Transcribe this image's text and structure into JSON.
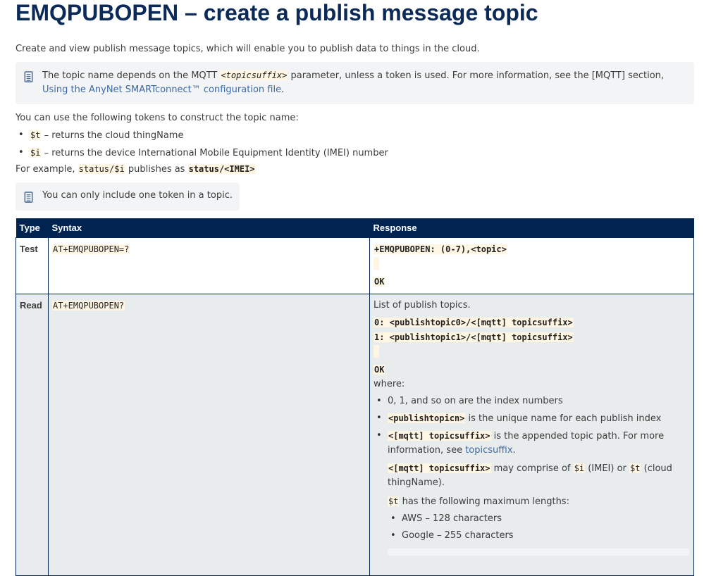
{
  "title": "EMQPUBOPEN – create a publish message topic",
  "intro": "Create and view publish message topics, which will enable you to publish data to things in the cloud.",
  "note1": {
    "pre": "The topic name depends on the MQTT ",
    "code": "<topicsuffix>",
    "post": " parameter, unless a token is used. For more information, see the [MQTT] section, ",
    "link": "Using the AnyNet SMARTconnect™ configuration file",
    "end": "."
  },
  "tokens_intro": "You can use the following tokens to construct the topic name:",
  "tokens": [
    {
      "code": "$t",
      "text": " – returns the cloud thingName"
    },
    {
      "code": "$i",
      "text": " – returns the device International Mobile Equipment Identity (IMEI) number"
    }
  ],
  "example": {
    "pre": "For example, ",
    "code1": "status/$i",
    "mid": " publishes as ",
    "code2": "status/<IMEI>"
  },
  "note2": "You can only include one token in a topic.",
  "table": {
    "headers": [
      "Type",
      "Syntax",
      "Response"
    ],
    "rows": [
      {
        "type": "Test",
        "syntax": "AT+EMQPUBOPEN=?",
        "resp1": "+EMQPUBOPEN: (0-7),<topic>",
        "ok": "OK"
      },
      {
        "type": "Read",
        "syntax": "AT+EMQPUBOPEN?",
        "list": "List of publish topics.",
        "line0": "0: <publishtopic0>/<[mqtt] topicsuffix>",
        "line1": "1: <publishtopic1>/<[mqtt] topicsuffix>",
        "ok": "OK",
        "where": "where:",
        "b1": "0, 1, and so on are the index numbers",
        "b2code": "<publishtopicn>",
        "b2": " is the unique name for each publish index",
        "b3code": "<[mqtt] topicsuffix>",
        "b3": " is the appended topic path. For more information, see ",
        "b3link": "topicsuffix",
        "b3end": ".",
        "p1code": "<[mqtt] topicsuffix>",
        "p1a": " may comprise of ",
        "p1c1": "$i",
        "p1b": " (IMEI) or ",
        "p1c2": "$t",
        "p1c": " (cloud thingName).",
        "p2code": "$t",
        "p2": " has the following maximum lengths:",
        "lengths": [
          "AWS – 128 characters",
          "Google – 255 characters"
        ]
      }
    ]
  }
}
